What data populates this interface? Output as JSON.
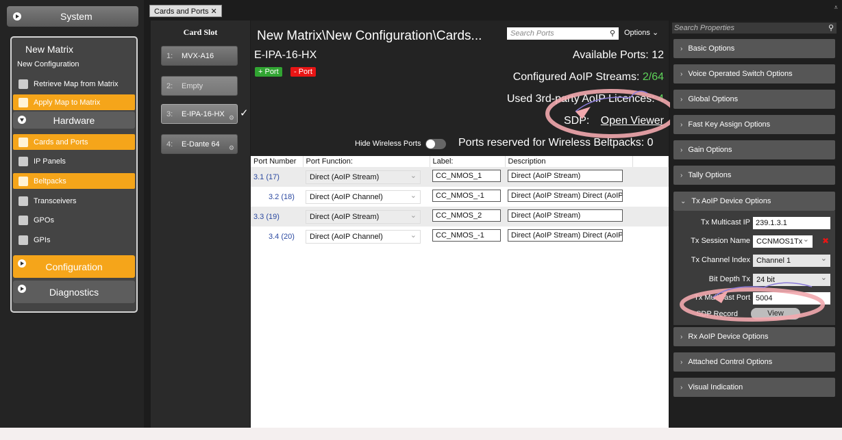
{
  "sidebar": {
    "system_label": "System",
    "matrix_title": "New Matrix",
    "matrix_subtitle": "New Configuration",
    "retrieve_label": "Retrieve Map from Matrix",
    "apply_label": "Apply Map to Matrix",
    "hardware_label": "Hardware",
    "items": [
      {
        "label": "Cards and Ports",
        "icon": "cards-icon",
        "active": true
      },
      {
        "label": "IP Panels",
        "icon": "ip-panel-icon",
        "active": false
      },
      {
        "label": "Beltpacks",
        "icon": "headset-icon",
        "active": true
      },
      {
        "label": "Transceivers",
        "icon": "antenna-icon",
        "active": false
      },
      {
        "label": "GPOs",
        "icon": "gpo-icon",
        "active": false
      },
      {
        "label": "GPIs",
        "icon": "gpi-icon",
        "active": false
      }
    ],
    "configuration_label": "Configuration",
    "diagnostics_label": "Diagnostics"
  },
  "tabs": [
    {
      "label": "Cards and Ports",
      "close": "✕"
    }
  ],
  "card_slots": {
    "header": "Card Slot",
    "cards": [
      {
        "num": "1:",
        "name": "MVX-A16"
      },
      {
        "num": "2:",
        "name": "Empty"
      },
      {
        "num": "3:",
        "name": "E-IPA-16-HX",
        "check": "✓"
      },
      {
        "num": "4:",
        "name": "E-Dante 64"
      }
    ]
  },
  "main": {
    "breadcrumb": "New Matrix\\New Configuration\\Cards...",
    "search_placeholder": "Search Ports",
    "options_label": "Options",
    "card_name": "E-IPA-16-HX",
    "add_port": "+ Port",
    "remove_port": "- Port",
    "available_ports_label": "Available Ports:",
    "available_ports_value": "12",
    "configured_label": "Configured AoIP Streams:",
    "configured_value": "2/64",
    "used_label": "Used 3rd-party AoIP Licences:",
    "used_value": "4",
    "sdp_label": "SDP:",
    "sdp_link": "Open Viewer",
    "hide_wireless_label": "Hide Wireless Ports",
    "reserved_label": "Ports reserved for Wireless Beltpacks:",
    "reserved_value": "0",
    "columns": [
      "Port Number",
      "Port Function:",
      "Label:",
      "Description"
    ],
    "rows": [
      {
        "port": "3.1 (17)",
        "function": "Direct (AoIP Stream)",
        "label": "CC_NMOS_1",
        "description": "Direct (AoIP Stream)"
      },
      {
        "port": "3.2 (18)",
        "function": "Direct (AoIP Channel)",
        "label": "CC_NMOS_-1",
        "description": "Direct (AoIP Stream) Direct (AoIP"
      },
      {
        "port": "3.3 (19)",
        "function": "Direct (AoIP Stream)",
        "label": "CC_NMOS_2",
        "description": "Direct (AoIP Stream)"
      },
      {
        "port": "3.4 (20)",
        "function": "Direct (AoIP Channel)",
        "label": "CC_NMOS_-1",
        "description": "Direct (AoIP Stream) Direct (AoIP"
      }
    ]
  },
  "properties": {
    "search_placeholder": "Search Properties",
    "sections": [
      "Basic Options",
      "Voice Operated Switch Options",
      "Global Options",
      "Fast Key Assign Options",
      "Gain Options",
      "Tally Options",
      "Tx AoIP Device Options",
      "Rx AoIP Device Options",
      "Attached Control Options",
      "Visual Indication"
    ],
    "tx": {
      "multicast_ip_label": "Tx Multicast IP",
      "multicast_ip_value": "239.1.3.1",
      "session_name_label": "Tx Session Name",
      "session_name_value": "CCNMOS1Tx",
      "channel_index_label": "Tx Channel Index",
      "channel_index_value": "Channel 1",
      "bit_depth_label": "Bit Depth Tx",
      "bit_depth_value": "24 bit",
      "multicast_port_label": "Tx Multicast Port",
      "multicast_port_value": "5004",
      "sdp_record_label": "SDP Record",
      "view_label": "View"
    }
  },
  "colors": {
    "accent": "#f5a51a",
    "highlight_ring": "#f2a9ae",
    "ok_green": "#5fd35a"
  }
}
